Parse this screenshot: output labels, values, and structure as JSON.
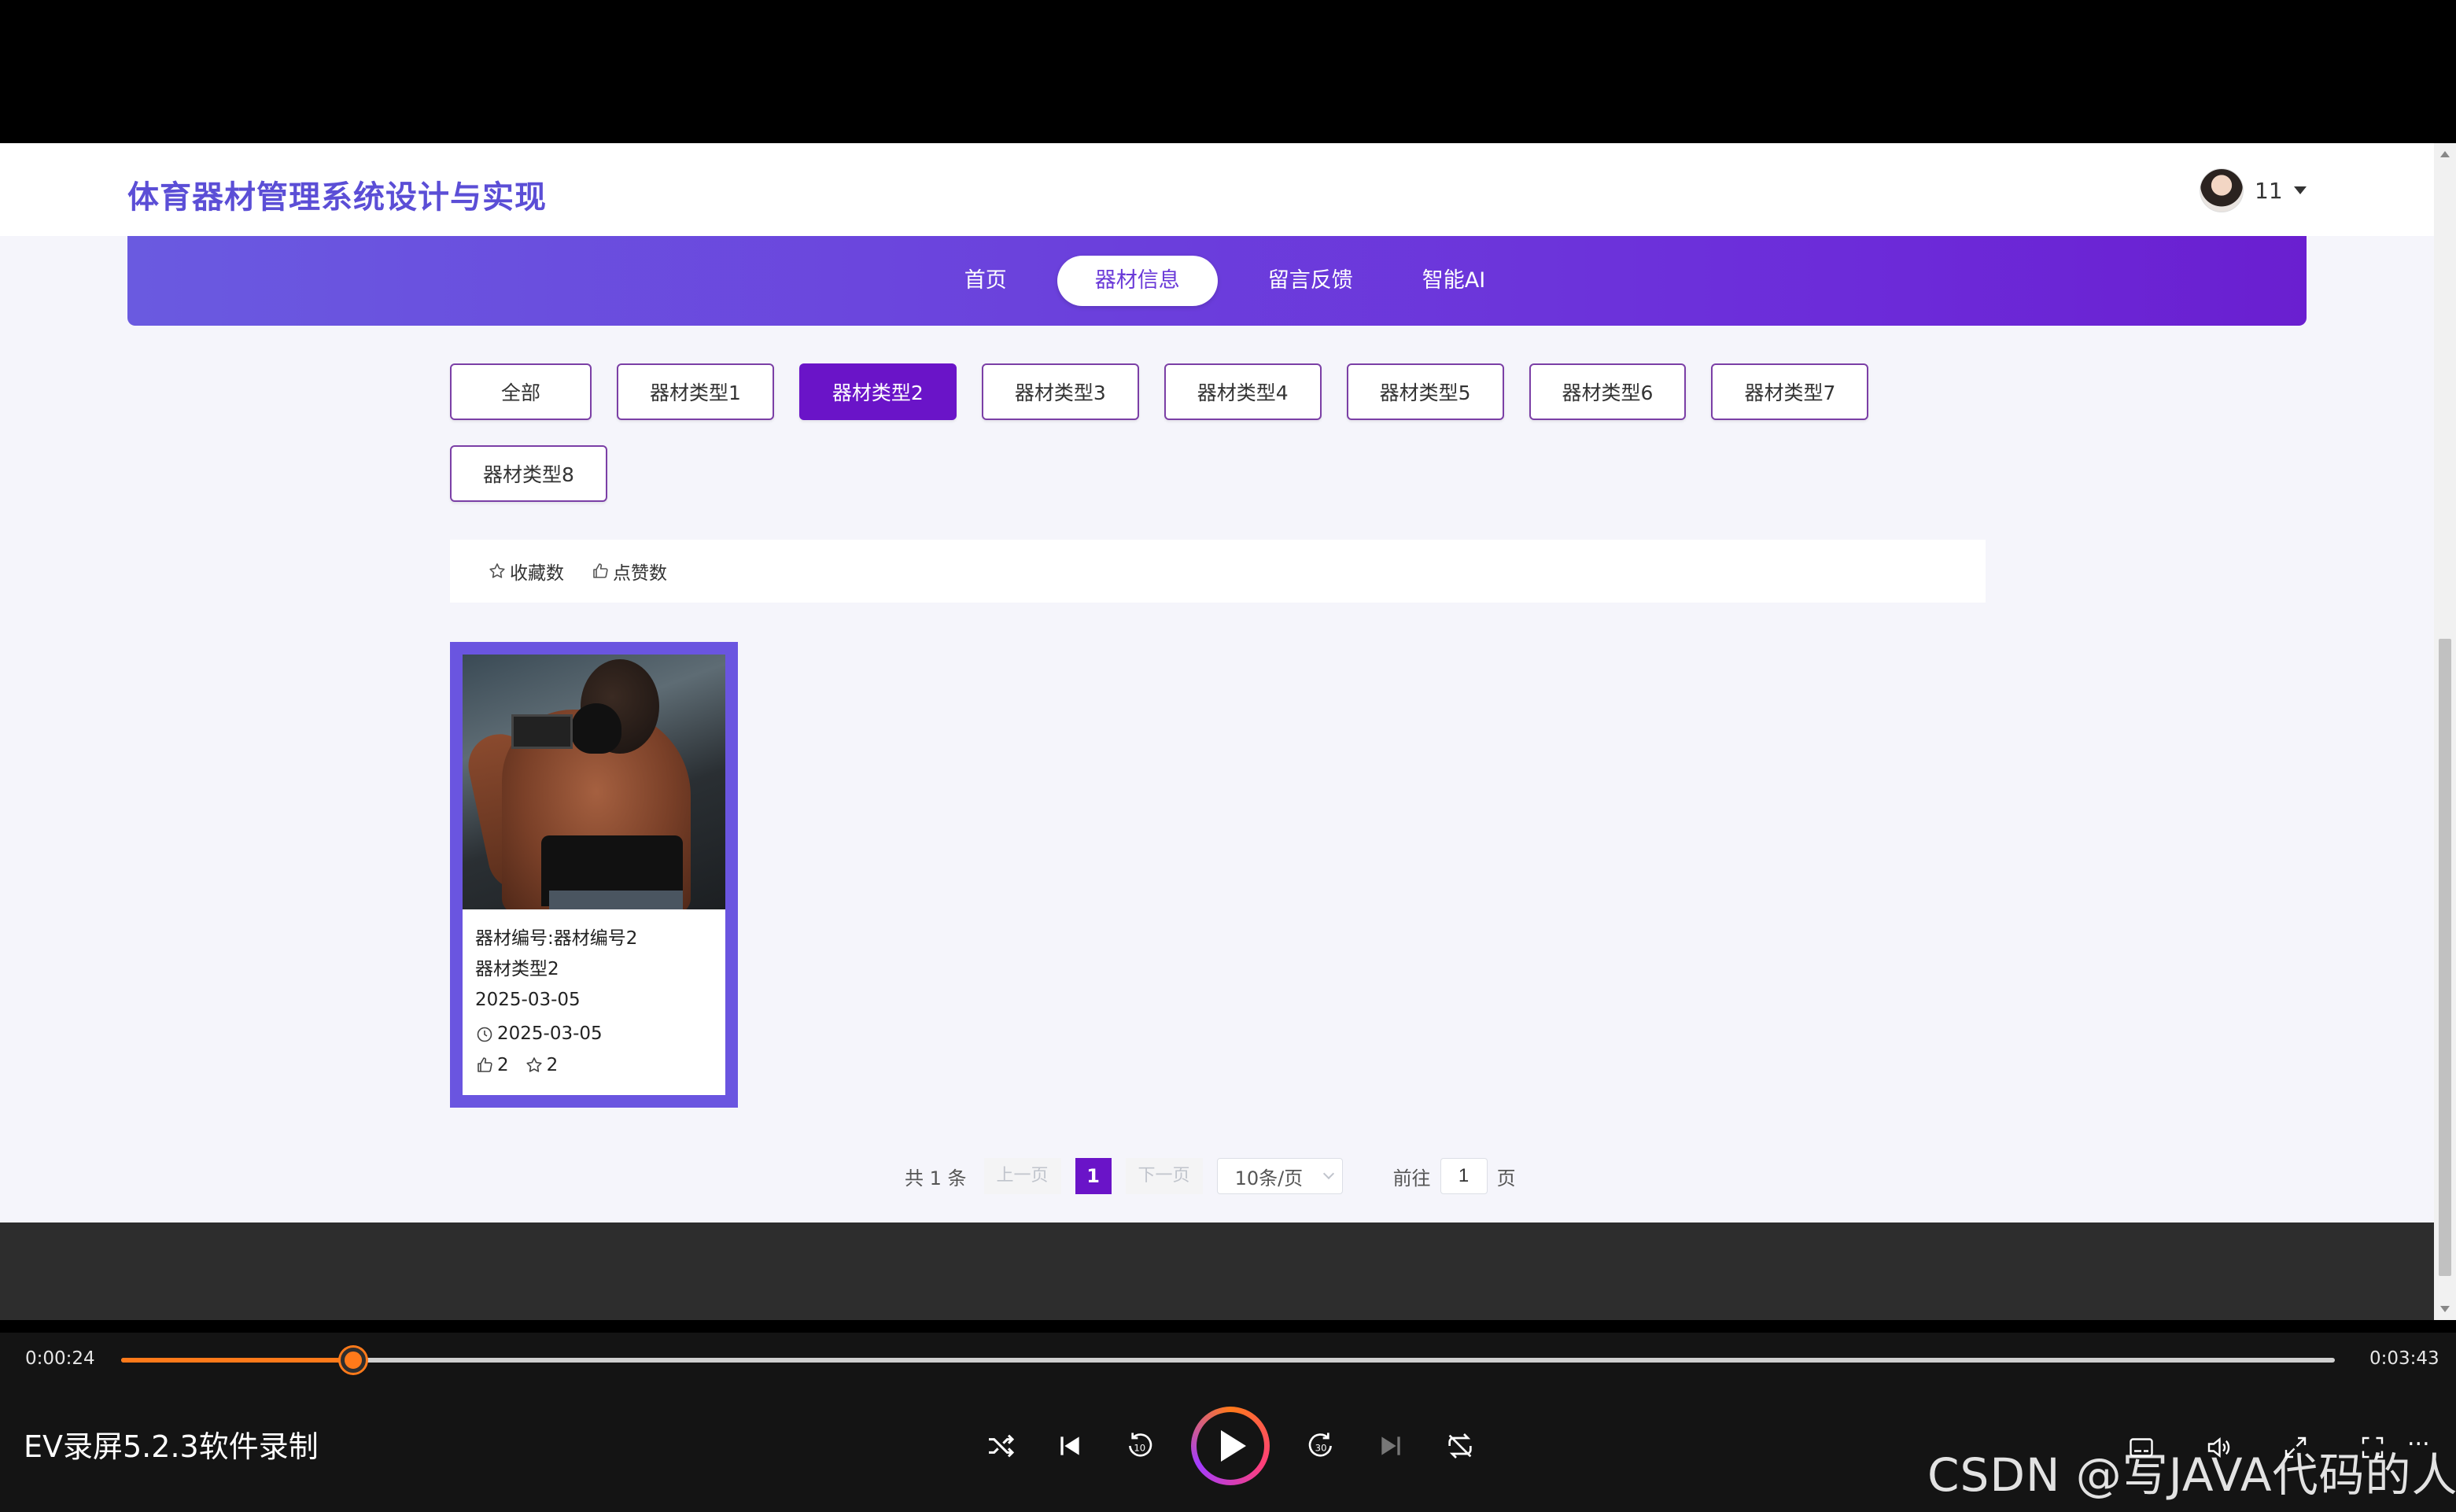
{
  "header": {
    "title": "体育器材管理系统设计与实现",
    "user_name": "11"
  },
  "nav": {
    "items": [
      {
        "label": "首页"
      },
      {
        "label": "器材信息"
      },
      {
        "label": "留言反馈"
      },
      {
        "label": "智能AI"
      }
    ],
    "active_index": 1
  },
  "filters": {
    "items": [
      {
        "label": "全部"
      },
      {
        "label": "器材类型1"
      },
      {
        "label": "器材类型2"
      },
      {
        "label": "器材类型3"
      },
      {
        "label": "器材类型4"
      },
      {
        "label": "器材类型5"
      },
      {
        "label": "器材类型6"
      },
      {
        "label": "器材类型7"
      },
      {
        "label": "器材类型8"
      }
    ],
    "active_index": 2
  },
  "sort": {
    "favorites_label": "收藏数",
    "likes_label": "点赞数"
  },
  "card": {
    "code": "器材编号:器材编号2",
    "type": "器材类型2",
    "date": "2025-03-05",
    "time": "2025-03-05",
    "likes": "2",
    "favorites": "2"
  },
  "pagination": {
    "total": "共 1 条",
    "prev": "上一页",
    "current": "1",
    "next": "下一页",
    "page_size": "10条/页",
    "goto": "前往",
    "goto_value": "1",
    "page_unit": "页"
  },
  "player": {
    "current_time": "0:00:24",
    "total_time": "0:03:43",
    "progress": 0.105,
    "title": "EV录屏5.2.3软件录制",
    "watermark": "CSDN @写JAVA代码的人",
    "more": "...",
    "accent": "#ff7a1a"
  },
  "colors": {
    "brand": "#5b4ed6",
    "nav_gradient_start": "#6a5ae0",
    "nav_gradient_end": "#6a1fd0",
    "active_filter": "#6a14c8"
  }
}
